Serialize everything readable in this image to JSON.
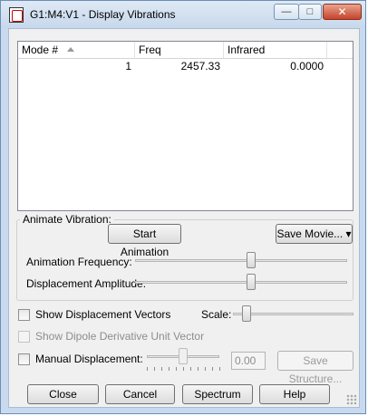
{
  "window": {
    "title": "G1:M4:V1 - Display Vibrations",
    "icon": "app-document-icon",
    "controls": {
      "minimize": "—",
      "maximize": "□",
      "close": "✕"
    }
  },
  "listview": {
    "columns": [
      "Mode #",
      "Freq",
      "Infrared"
    ],
    "sort_column": "Mode #",
    "rows": [
      {
        "mode": "1",
        "freq": "2457.33",
        "infrared": "0.0000"
      }
    ]
  },
  "animate": {
    "group_label": "Animate Vibration:",
    "start_button": "Start Animation",
    "save_movie_button": "Save Movie...",
    "frequency_label": "Animation Frequency:",
    "amplitude_label": "Displacement Amplitude:",
    "frequency_level": 0.55,
    "amplitude_level": 0.55
  },
  "options": {
    "show_displacement_vectors": "Show Displacement Vectors",
    "show_displacement_checked": false,
    "scale_label": "Scale:",
    "scale_level": 0.02,
    "show_dipole": "Show Dipole Derivative Unit Vector",
    "manual_displacement": "Manual Displacement:",
    "manual_checked": false,
    "manual_level": 0.5,
    "manual_value": "0.00",
    "save_structure_button": "Save Structure..."
  },
  "buttons": {
    "close": "Close",
    "cancel": "Cancel",
    "spectrum": "Spectrum",
    "help": "Help"
  },
  "colors": {
    "title_bar": "#c7d8ec",
    "client_bg": "#f0f0f0",
    "close_button": "#c7432a"
  }
}
